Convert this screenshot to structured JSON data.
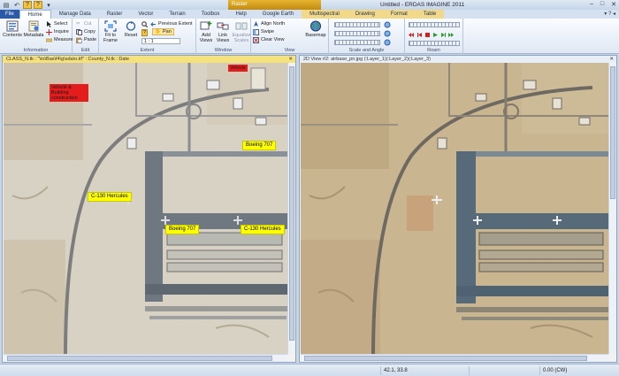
{
  "window": {
    "context_tab_header": "Raster",
    "title": "Untitled - ERDAS IMAGINE 2011",
    "controls": [
      "–",
      "□",
      "✕"
    ]
  },
  "quick_access": [
    "▤",
    "↶",
    "?",
    "?",
    "▾"
  ],
  "ribbon_tabs": [
    "File",
    "Home",
    "Manage Data",
    "Raster",
    "Vector",
    "Terrain",
    "Toolbox",
    "Help",
    "Google Earth",
    "Multispectral",
    "Drawing",
    "Format",
    "Table"
  ],
  "help_area": "▾  ?  ◂",
  "groups": {
    "information": {
      "title": "Information",
      "contents": "Contents",
      "metadata": "Metadata",
      "select": "Select",
      "inquire": "Inquire",
      "measure": "Measure"
    },
    "edit": {
      "title": "Edit",
      "cut": "Cut",
      "copy": "Copy",
      "paste": "Paste",
      "delete_mark": "✕"
    },
    "extent": {
      "title": "Extent",
      "fit_to_frame": "Fit to Frame",
      "reset": "Reset",
      "previous_extent": "Previous Extent",
      "pan": "Pan",
      "scale": "1 : 1",
      "help_mark": "?"
    },
    "window_group": {
      "title": "Window",
      "add_views": "Add Views",
      "link_views": "Link Views",
      "equalize_scales": "Equalize Scales"
    },
    "view": {
      "title": "View",
      "align_north": "Align North",
      "swipe": "Swipe",
      "clear_view": "Clear View",
      "basemap": "Basemap"
    },
    "scale_and_angle": {
      "title": "Scale and Angle"
    },
    "roam": {
      "title": "Roam"
    }
  },
  "panes": {
    "left": {
      "title": "CLASS_N.tk : \"\\to\\Bas\\f4\\g\\sda\\o.tif\" : County_N.tk : Date",
      "labels": [
        {
          "text": "Boeing 707",
          "kind": "yellow"
        },
        {
          "text": "C-130 Hercules",
          "kind": "yellow"
        },
        {
          "text": "Boeing 707",
          "kind": "yellow"
        },
        {
          "text": "C-130 Hercules",
          "kind": "yellow"
        },
        {
          "text": "Vehicle",
          "kind": "red"
        },
        {
          "text": "Vehicle & Building construction",
          "kind": "red"
        }
      ]
    },
    "right": {
      "title": "2D View #2: airbase_pn.jpg (:Layer_1)(:Layer_2)(:Layer_3)"
    }
  },
  "status": {
    "coords": "42.1, 33.8",
    "rotation": "0.00 (CW)"
  },
  "colors": {
    "ribbon_bg": "#e6eef8",
    "file_tab": "#2a5aa8",
    "context_tab": "#e6b52e",
    "label_yellow": "#ffff00",
    "label_red": "#e31c1c",
    "desert": "#c9b590",
    "tarmac": "#6f7880"
  }
}
